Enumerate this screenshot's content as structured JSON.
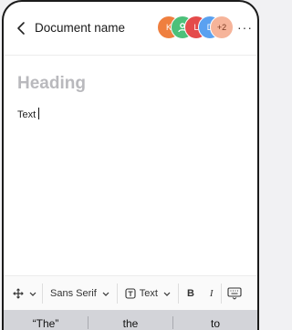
{
  "header": {
    "title": "Document name",
    "back_icon": "chevron-left-icon",
    "more_icon": "more-horizontal-icon",
    "more_label": "···",
    "avatars": [
      {
        "initial": "K",
        "color": "#ef7f3f"
      },
      {
        "initial": "",
        "color": "#4cc07a"
      },
      {
        "initial": "L",
        "color": "#e44b4b"
      },
      {
        "initial": "D",
        "color": "#5aa1f0"
      }
    ],
    "overflow_count": "+2",
    "overflow_color": "#f6b49a"
  },
  "editor": {
    "heading_placeholder": "Heading",
    "body_text": "Text"
  },
  "toolbar": {
    "insert_icon": "move-icon",
    "font_label": "Sans Serif",
    "style_icon": "text-style-icon",
    "style_label": "Text",
    "bold_label": "B",
    "italic_label": "I",
    "keyboard_icon": "keyboard-icon"
  },
  "keyboard": {
    "suggestions": [
      "“The”",
      "the",
      "to"
    ]
  }
}
